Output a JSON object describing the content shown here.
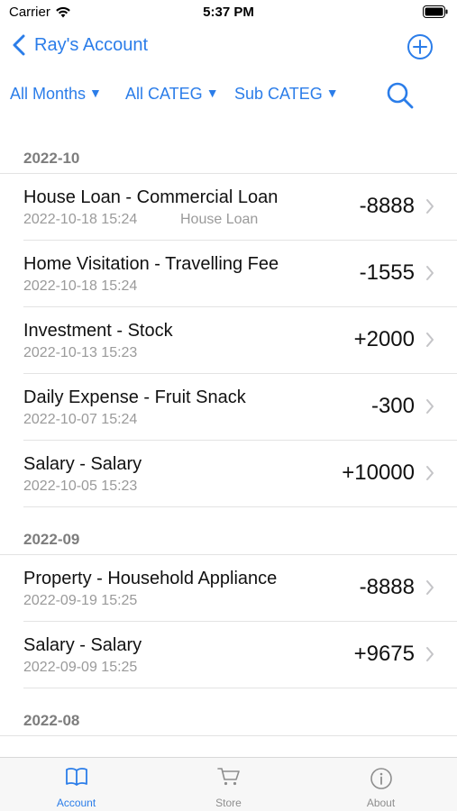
{
  "status_bar": {
    "carrier": "Carrier",
    "time": "5:37 PM"
  },
  "nav": {
    "back_label": "Ray's Account",
    "add_icon": "plus-circle-icon",
    "accent_color": "#2b7de9"
  },
  "filters": {
    "months": "All Months",
    "category": "All CATEG",
    "sub_category": "Sub CATEG",
    "caret": "▼",
    "search_icon": "search-icon"
  },
  "sections": [
    {
      "header": "2022-10",
      "rows": [
        {
          "title": "House Loan - Commercial Loan",
          "date": "2022-10-18 15:24",
          "note": "House Loan",
          "amount": "-8888"
        },
        {
          "title": "Home Visitation - Travelling Fee",
          "date": "2022-10-18 15:24",
          "note": "",
          "amount": "-1555"
        },
        {
          "title": "Investment - Stock",
          "date": "2022-10-13 15:23",
          "note": "",
          "amount": "+2000"
        },
        {
          "title": "Daily Expense - Fruit Snack",
          "date": "2022-10-07 15:24",
          "note": "",
          "amount": "-300"
        },
        {
          "title": "Salary - Salary",
          "date": "2022-10-05 15:23",
          "note": "",
          "amount": "+10000"
        }
      ]
    },
    {
      "header": "2022-09",
      "rows": [
        {
          "title": "Property - Household Appliance",
          "date": "2022-09-19 15:25",
          "note": "",
          "amount": "-8888"
        },
        {
          "title": "Salary - Salary",
          "date": "2022-09-09 15:25",
          "note": "",
          "amount": "+9675"
        }
      ]
    },
    {
      "header": "2022-08",
      "rows": []
    }
  ],
  "tabs": [
    {
      "label": "Account",
      "icon": "book-icon",
      "active": true
    },
    {
      "label": "Store",
      "icon": "cart-icon",
      "active": false
    },
    {
      "label": "About",
      "icon": "info-icon",
      "active": false
    }
  ]
}
